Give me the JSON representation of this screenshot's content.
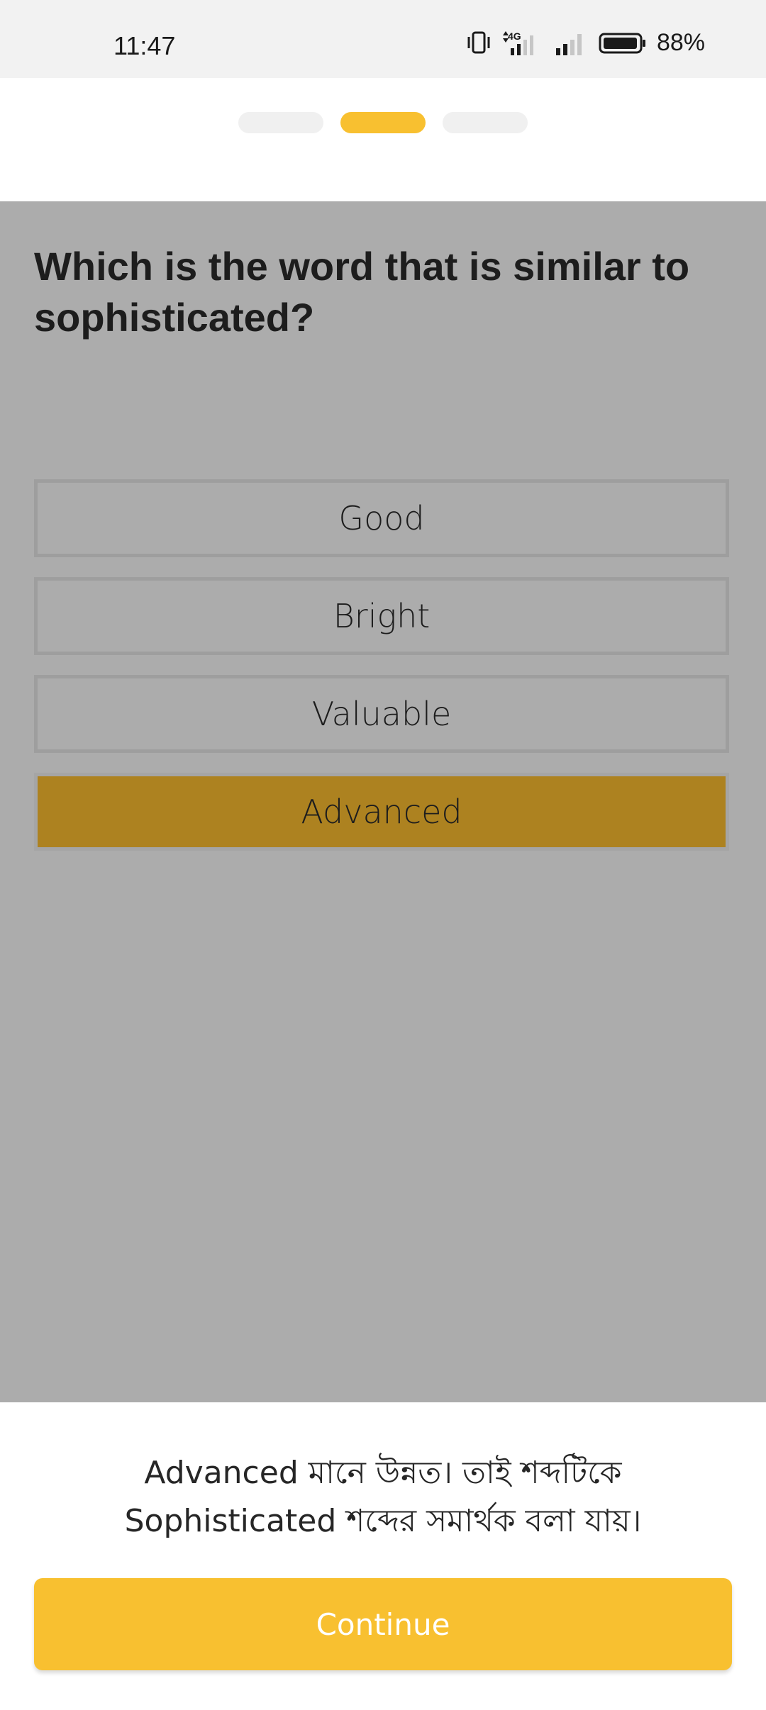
{
  "status": {
    "time": "11:47",
    "battery": "88%",
    "icons": [
      "vibrate-icon",
      "network-4g-icon",
      "signal-icon",
      "battery-icon"
    ]
  },
  "progress": {
    "steps": 3,
    "current": 2,
    "active_color": "#f8c030",
    "inactive_color": "#f0f0f0"
  },
  "quiz": {
    "question": "Which is the word that is similar to sophisticated?",
    "options": [
      "Good",
      "Bright",
      "Valuable",
      "Advanced"
    ],
    "selected_option": "Advanced"
  },
  "feedback": {
    "line1": "Advanced মানে উন্নত। তাই শব্দটিকে",
    "line2": "Sophisticated শব্দের সমার্থক বলা যায়।"
  },
  "actions": {
    "continue_label": "Continue"
  },
  "colors": {
    "accent": "#f8c030",
    "selected_option_bg": "#ad8220",
    "overlay": "#acacac"
  }
}
